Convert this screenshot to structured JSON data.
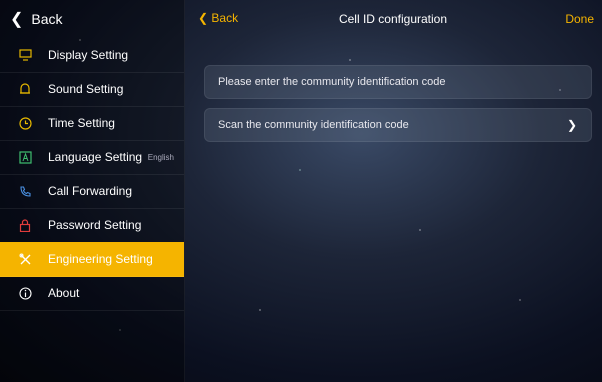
{
  "sidebar": {
    "back_label": "Back",
    "items": [
      {
        "label": "Display Setting",
        "icon": "monitor-icon",
        "value": ""
      },
      {
        "label": "Sound Setting",
        "icon": "bell-icon",
        "value": ""
      },
      {
        "label": "Time Setting",
        "icon": "clock-icon",
        "value": ""
      },
      {
        "label": "Language Setting",
        "icon": "language-icon",
        "value": "English"
      },
      {
        "label": "Call Forwarding",
        "icon": "phone-forward-icon",
        "value": ""
      },
      {
        "label": "Password Setting",
        "icon": "lock-icon",
        "value": ""
      },
      {
        "label": "Engineering Setting",
        "icon": "tools-icon",
        "value": "",
        "active": true
      },
      {
        "label": "About",
        "icon": "info-icon",
        "value": ""
      }
    ]
  },
  "header": {
    "back_label": "Back",
    "title": "Cell ID configuration",
    "done_label": "Done"
  },
  "main": {
    "code_field_placeholder": "Please enter the community identification code",
    "scan_label": "Scan the community identification code"
  },
  "colors": {
    "accent": "#f5b400"
  }
}
